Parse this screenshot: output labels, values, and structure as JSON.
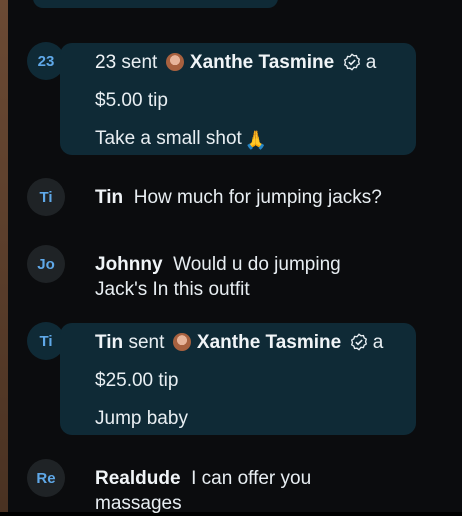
{
  "messages": [
    {
      "type": "tip",
      "avatar": "23",
      "sender": "23",
      "sent_word": "sent",
      "creator": "Xanthe Tasmine",
      "a_word": "a",
      "amount": "$5.00 tip",
      "note": "Take a small shot",
      "note_emoji": "folded-hands"
    },
    {
      "type": "chat",
      "avatar": "Ti",
      "sender": "Tin",
      "text": "How much for jumping jacks?"
    },
    {
      "type": "chat",
      "avatar": "Jo",
      "sender": "Johnny",
      "text_line1": "Would u do jumping",
      "text_line2": "Jack's In this outfit"
    },
    {
      "type": "tip",
      "avatar": "Ti",
      "sender": "Tin",
      "sent_word": "sent",
      "creator": "Xanthe Tasmine",
      "a_word": "a",
      "amount": "$25.00 tip",
      "note": "Jump baby"
    },
    {
      "type": "chat",
      "avatar": "Re",
      "sender": "Realdude",
      "text_line1": "I can offer you",
      "text_line2": "massages"
    }
  ],
  "colors": {
    "background": "#0b0c0e",
    "tip_bubble": "#0f2a36",
    "avatar_text": "#5fa8e8"
  }
}
